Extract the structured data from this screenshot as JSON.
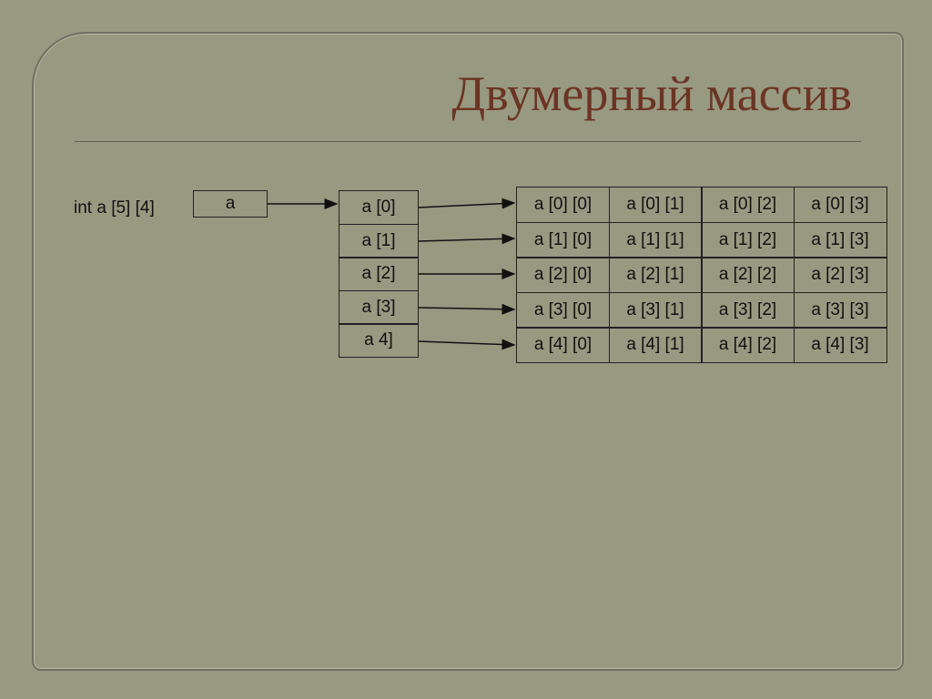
{
  "title": "Двумерный массив",
  "declaration": "int a [5] [4]",
  "root_box": "a",
  "mid_col": [
    "a [0]",
    "a [1]",
    "a [2]",
    "a [3]",
    "a 4]"
  ],
  "grid": [
    [
      "a [0] [0]",
      "a [0] [1]",
      "a [0] [2]",
      "a [0] [3]"
    ],
    [
      "a [1] [0]",
      "a [1] [1]",
      "a [1] [2]",
      "a [1] [3]"
    ],
    [
      "a [2] [0]",
      "a [2] [1]",
      "a [2] [2]",
      "a [2] [3]"
    ],
    [
      "a [3] [0]",
      "a [3] [1]",
      "a [3] [2]",
      "a [3] [3]"
    ],
    [
      "a [4] [0]",
      "a [4] [1]",
      "a [4] [2]",
      "a [4] [3]"
    ]
  ]
}
